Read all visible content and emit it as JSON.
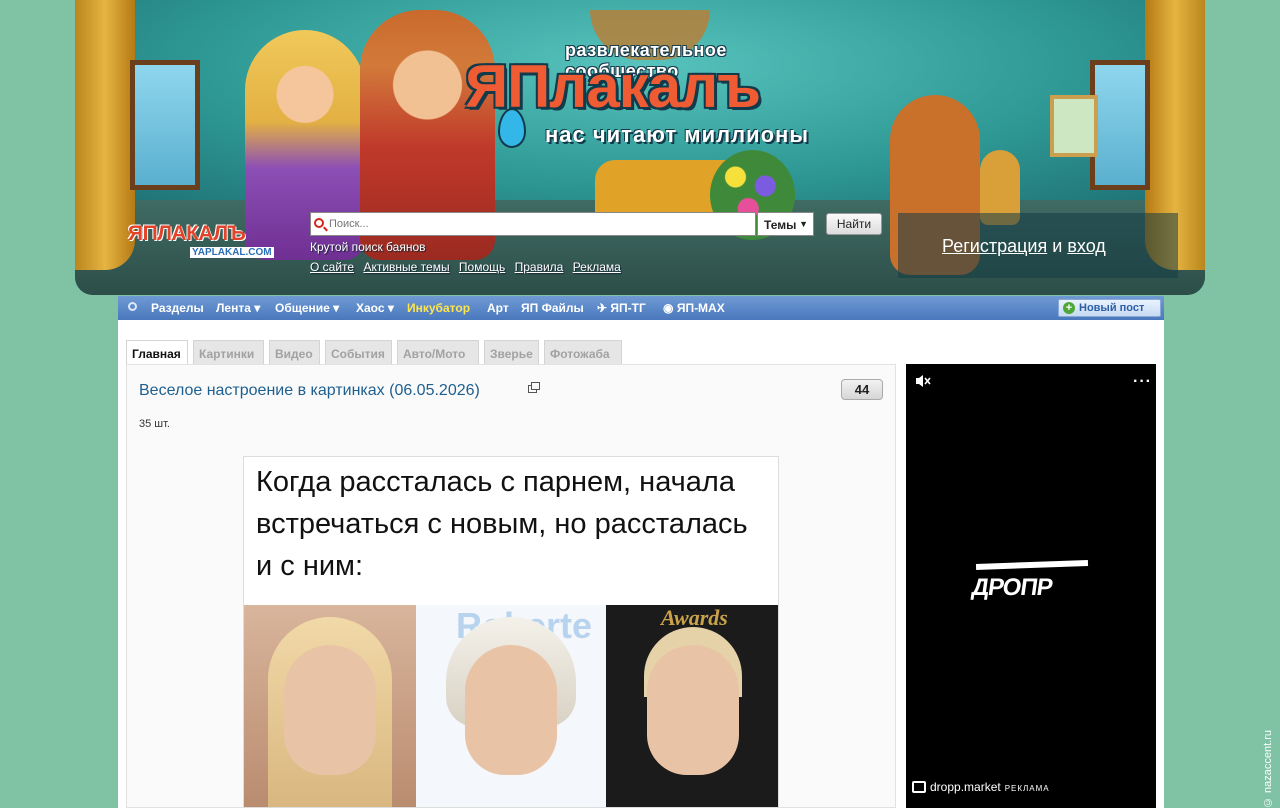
{
  "header": {
    "tagline": "развлекательное сообщество",
    "logo_word": "ЯПлакалъ",
    "slogan": "нас читают миллионы",
    "small_logo_word": "ЯПЛАКАЛЪ",
    "small_logo_url": "YAPLAKAL.COM",
    "search": {
      "placeholder": "Поиск...",
      "scope": "Темы",
      "button": "Найти",
      "hint": "Крутой поиск баянов"
    },
    "links": [
      "О сайте",
      "Активные темы",
      "Помощь",
      "Правила",
      "Реклама"
    ],
    "auth": {
      "register": "Регистрация",
      "and": "и",
      "login": "вход"
    }
  },
  "nav": {
    "items": [
      {
        "label": "Разделы"
      },
      {
        "label": "Лента ▾"
      },
      {
        "label": "Общение ▾"
      },
      {
        "label": "Хаос ▾"
      },
      {
        "label": "Инкубатор"
      },
      {
        "label": "Арт"
      },
      {
        "label": "ЯП Файлы"
      },
      {
        "label": "ЯП-ТГ"
      },
      {
        "label": "ЯП-MAX"
      }
    ],
    "new_post": "Новый пост"
  },
  "tabs": [
    "Главная",
    "Картинки",
    "Видео",
    "События",
    "Авто/Мото",
    "Зверье",
    "Фотожаба"
  ],
  "post": {
    "title": "Веселое настроение в картинках (06.05.2026)",
    "comments": "44",
    "count": "35 шт.",
    "meme_text": "Когда рассталась с парнем, начала встречаться с новым, но рассталась и с ним:",
    "photo2_brand": "Roberte",
    "photo3_brand": "Awards"
  },
  "ad": {
    "more": "···",
    "logo": "ДРОПР",
    "site": "dropp.market",
    "label": "РЕКЛАМА"
  },
  "watermark": "© nazaccent.ru",
  "colors": {
    "page_bg": "#7fc3a4",
    "nav_bg": "#4a78bd",
    "incubator": "#ffe54a",
    "link": "#1f5f8f"
  }
}
